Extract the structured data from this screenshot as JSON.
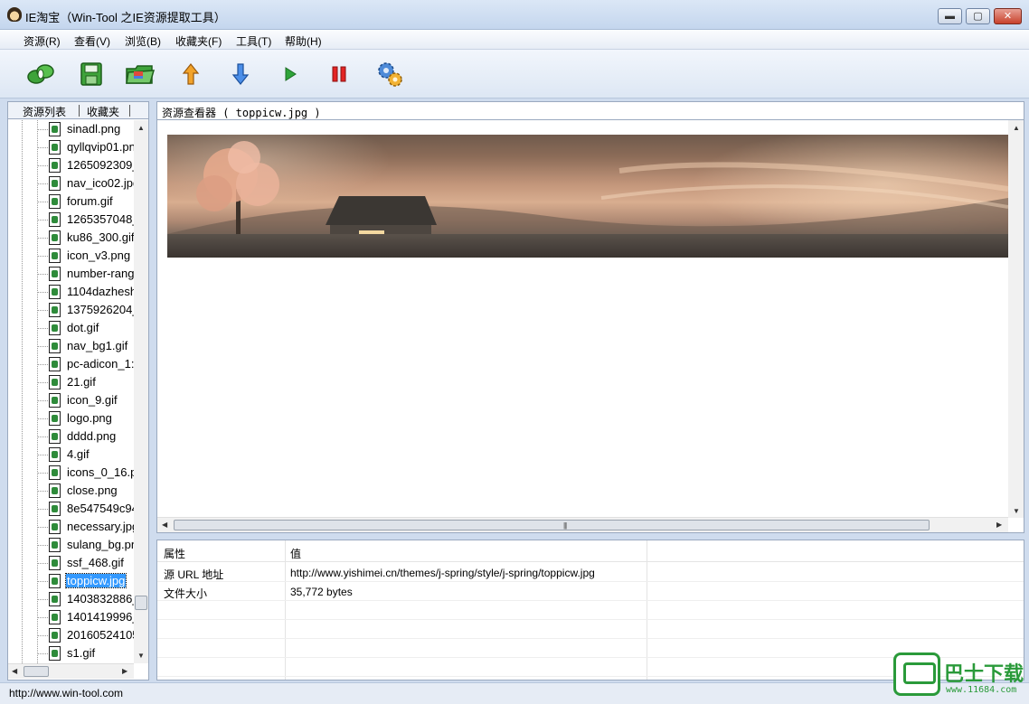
{
  "window": {
    "title": "IE淘宝（Win-Tool 之IE资源提取工具）",
    "buttons": {
      "min": "▬",
      "max": "▢",
      "close": "✕"
    }
  },
  "menu": [
    {
      "label": "资源(R)"
    },
    {
      "label": "查看(V)"
    },
    {
      "label": "浏览(B)"
    },
    {
      "label": "收藏夹(F)"
    },
    {
      "label": "工具(T)"
    },
    {
      "label": "帮助(H)"
    }
  ],
  "toolbar": {
    "icons": [
      "connect-icon",
      "save-icon",
      "open-folder-icon",
      "up-arrow-icon",
      "down-arrow-icon",
      "play-icon",
      "pause-icon",
      "settings-gear-icon"
    ]
  },
  "left_panel": {
    "tabs": [
      "资源列表",
      "收藏夹"
    ],
    "files": [
      "sinadl.png",
      "qyllqvip01.pn",
      "1265092309_",
      "nav_ico02.jpg",
      "forum.gif",
      "1265357048_",
      "ku86_300.gif",
      "icon_v3.png",
      "number-rang",
      "1104dazheshi",
      "1375926204_",
      "dot.gif",
      "nav_bg1.gif",
      "pc-adicon_1:",
      "21.gif",
      "icon_9.gif",
      "logo.png",
      "dddd.png",
      "4.gif",
      "icons_0_16.p",
      "close.png",
      "8e547549c94",
      "necessary.jpg",
      "sulang_bg.pn",
      "ssf_468.gif",
      "toppicw.jpg",
      "1403832886_",
      "1401419996_",
      "20160524105",
      "s1.gif"
    ],
    "selected_file": "toppicw.jpg"
  },
  "viewer": {
    "title": "资源查看器 ( toppicw.jpg )"
  },
  "properties": {
    "header": {
      "key": "属性",
      "value": "值"
    },
    "rows": [
      {
        "key": "源 URL 地址",
        "value": "http://www.yishimei.cn/themes/j-spring/style/j-spring/toppicw.jpg"
      },
      {
        "key": "文件大小",
        "value": "35,772 bytes"
      }
    ]
  },
  "status": {
    "text": "http://www.win-tool.com"
  },
  "watermark": {
    "text": "巴士下载",
    "sub": "www.11684.com"
  },
  "colors": {
    "selection": "#3399ff",
    "file_icon_green": "#2e8b3a",
    "watermark_green": "#2a9a3a"
  }
}
